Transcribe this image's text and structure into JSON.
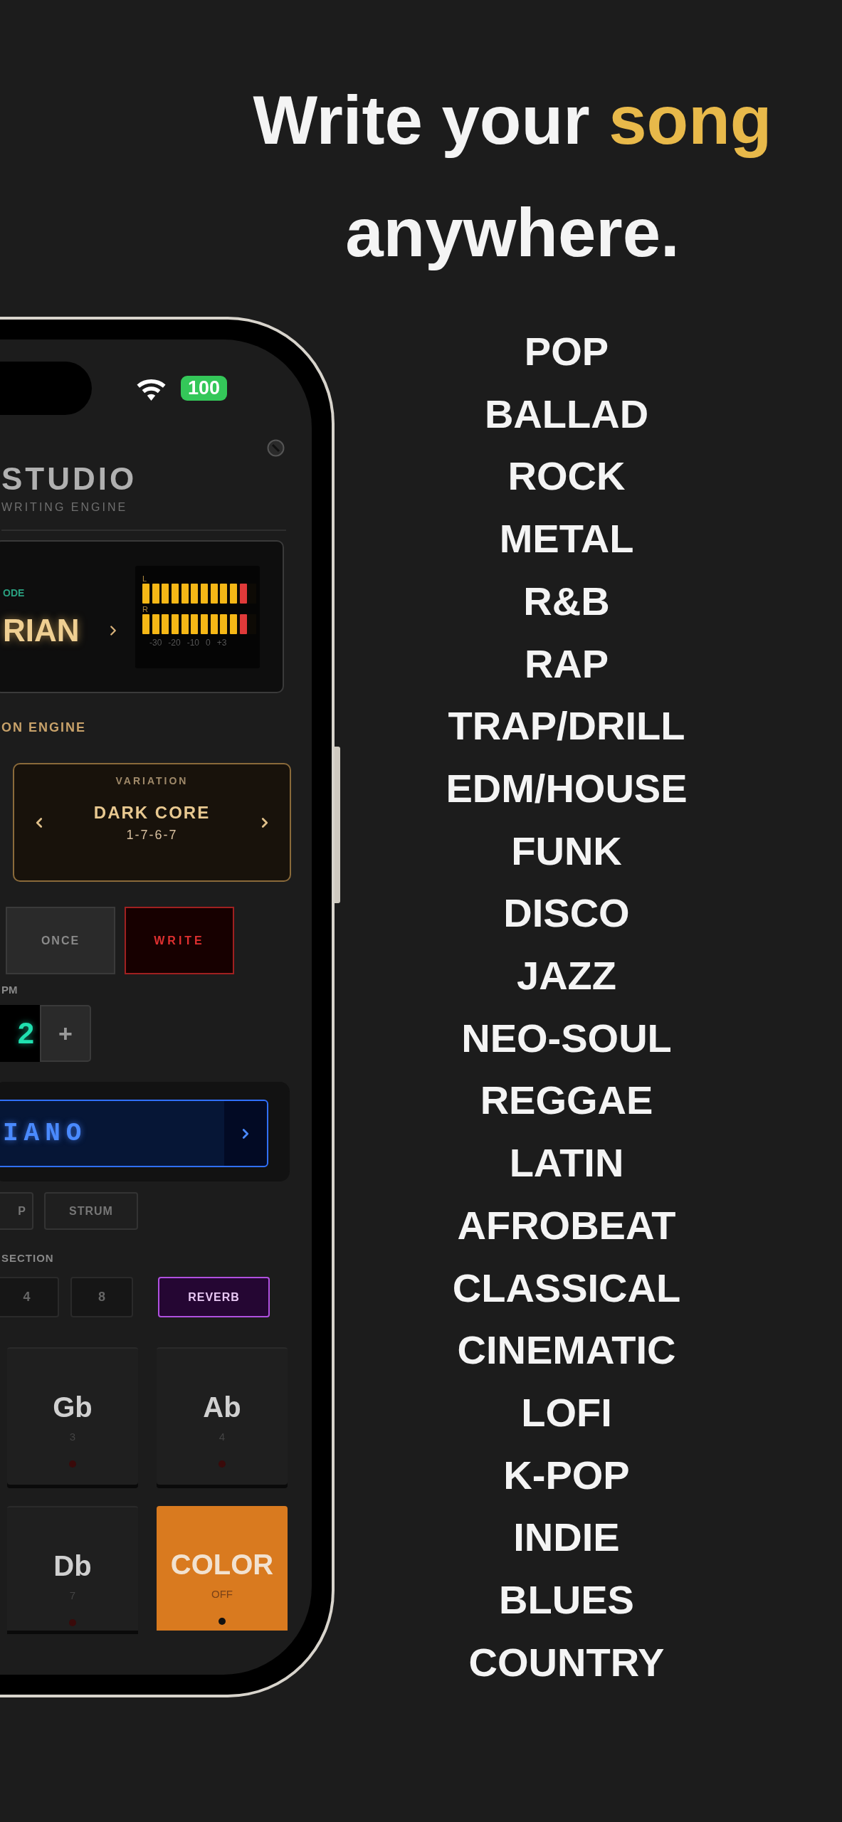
{
  "headline": {
    "lines": [
      [
        {
          "text": "Write your",
          "highlight": false
        },
        {
          "text": "song",
          "highlight": true
        }
      ],
      [
        {
          "text": "anywhere.",
          "highlight": false
        }
      ]
    ]
  },
  "genres": [
    "POP",
    "BALLAD",
    "ROCK",
    "METAL",
    "R&B",
    "RAP",
    "TRAP/DRILL",
    "EDM/HOUSE",
    "FUNK",
    "DISCO",
    "JAZZ",
    "NEO-SOUL",
    "REGGAE",
    "LATIN",
    "AFROBEAT",
    "CLASSICAL",
    "CINEMATIC",
    "LOFI",
    "K-POP",
    "INDIE",
    "BLUES",
    "COUNTRY"
  ],
  "phone": {
    "status_bar": {
      "battery": "100"
    },
    "app": {
      "title": "STUDIO",
      "subtitle": "WRITING ENGINE"
    },
    "mode": {
      "label": "ODE",
      "value": "RIAN"
    },
    "meter": {
      "channels": [
        {
          "label": "L",
          "level": 0.917
        },
        {
          "label": "R",
          "level": 0.917
        }
      ],
      "scale": [
        "-30",
        "-20",
        "-10",
        "0",
        "+3"
      ]
    },
    "engine": {
      "label": "ON ENGINE"
    },
    "variation": {
      "label": "VARIATION",
      "name": "DARK CORE",
      "pattern": "1-7-6-7"
    },
    "actions": [
      {
        "label": "ONCE",
        "kind": "plain"
      },
      {
        "label": "WRITE",
        "kind": "record"
      }
    ],
    "bpm": {
      "label": "PM",
      "value": "2",
      "increment": "+"
    },
    "instrument": {
      "name": "IANO"
    },
    "play_modes": [
      "P",
      "STRUM"
    ],
    "section": {
      "label": "SECTION",
      "lengths": [
        "4",
        "8"
      ]
    },
    "effect": {
      "label": "REVERB",
      "on": true
    },
    "pads": [
      {
        "kind": "note",
        "note": "Gb",
        "degree": "3"
      },
      {
        "kind": "note",
        "note": "Ab",
        "degree": "4"
      },
      {
        "kind": "note",
        "note": "Db",
        "degree": "7"
      },
      {
        "kind": "color",
        "note": "COLOR",
        "degree": "OFF"
      }
    ]
  }
}
